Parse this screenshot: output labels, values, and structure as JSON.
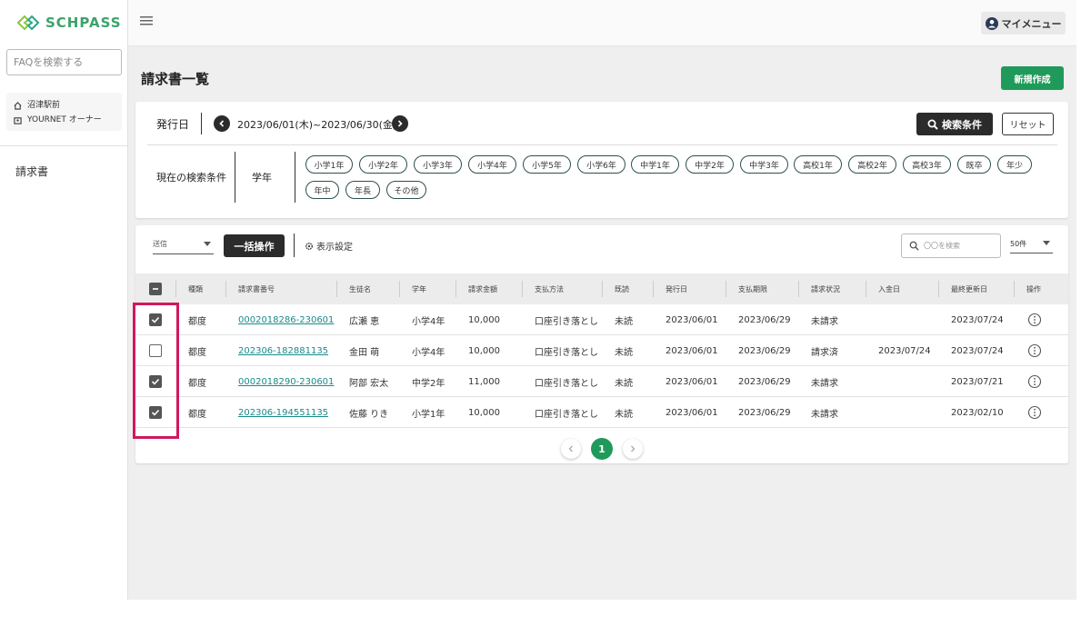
{
  "sidebar": {
    "logo_text": "SCHPASS",
    "faq_placeholder": "FAQを検索する",
    "school": "沼津駅前",
    "owner": "YOURNET オーナー",
    "nav_item": "請求書"
  },
  "header": {
    "my_menu": "マイメニュー"
  },
  "page": {
    "title": "請求書一覧",
    "new_button": "新規作成"
  },
  "filter": {
    "date_label": "発行日",
    "date_range": "2023/06/01(木)~2023/06/30(金)",
    "search_button": "検索条件",
    "reset_button": "リセット",
    "current_label": "現在の検索条件",
    "grade_label": "学年",
    "chips": [
      "小学1年",
      "小学2年",
      "小学3年",
      "小学4年",
      "小学5年",
      "小学6年",
      "中学1年",
      "中学2年",
      "中学3年",
      "高校1年",
      "高校2年",
      "高校3年",
      "既卒",
      "年少",
      "年中",
      "年長",
      "その他"
    ]
  },
  "toolbar": {
    "send_select": "送信",
    "bulk_button": "一括操作",
    "display_settings": "表示設定",
    "search_placeholder": "〇〇を検索",
    "per_page": "50件"
  },
  "table": {
    "columns": [
      "種類",
      "請求書番号",
      "生徒名",
      "学年",
      "請求金額",
      "支払方法",
      "既読",
      "発行日",
      "支払期限",
      "請求状況",
      "入金日",
      "最終更新日",
      "操作"
    ],
    "rows": [
      {
        "checked": true,
        "type": "都度",
        "number": "0002018286-230601",
        "student": "広瀬 恵",
        "grade": "小学4年",
        "amount": "10,000",
        "method": "口座引き落とし",
        "read": "未読",
        "issued": "2023/06/01",
        "due": "2023/06/29",
        "status": "未請求",
        "paid": "",
        "updated": "2023/07/24"
      },
      {
        "checked": false,
        "type": "都度",
        "number": "202306-182881135",
        "student": "金田 萌",
        "grade": "小学4年",
        "amount": "10,000",
        "method": "口座引き落とし",
        "read": "未読",
        "issued": "2023/06/01",
        "due": "2023/06/29",
        "status": "請求済",
        "paid": "2023/07/24",
        "updated": "2023/07/24"
      },
      {
        "checked": true,
        "type": "都度",
        "number": "0002018290-230601",
        "student": "阿部 宏太",
        "grade": "中学2年",
        "amount": "11,000",
        "method": "口座引き落とし",
        "read": "未読",
        "issued": "2023/06/01",
        "due": "2023/06/29",
        "status": "未請求",
        "paid": "",
        "updated": "2023/07/21"
      },
      {
        "checked": true,
        "type": "都度",
        "number": "202306-194551135",
        "student": "佐藤 りき",
        "grade": "小学1年",
        "amount": "10,000",
        "method": "口座引き落とし",
        "read": "未読",
        "issued": "2023/06/01",
        "due": "2023/06/29",
        "status": "未請求",
        "paid": "",
        "updated": "2023/02/10"
      }
    ]
  },
  "pagination": {
    "current": "1"
  },
  "colors": {
    "brand_green": "#1f9a5a",
    "link_teal": "#1a8a8a",
    "highlight": "#d0185e"
  }
}
